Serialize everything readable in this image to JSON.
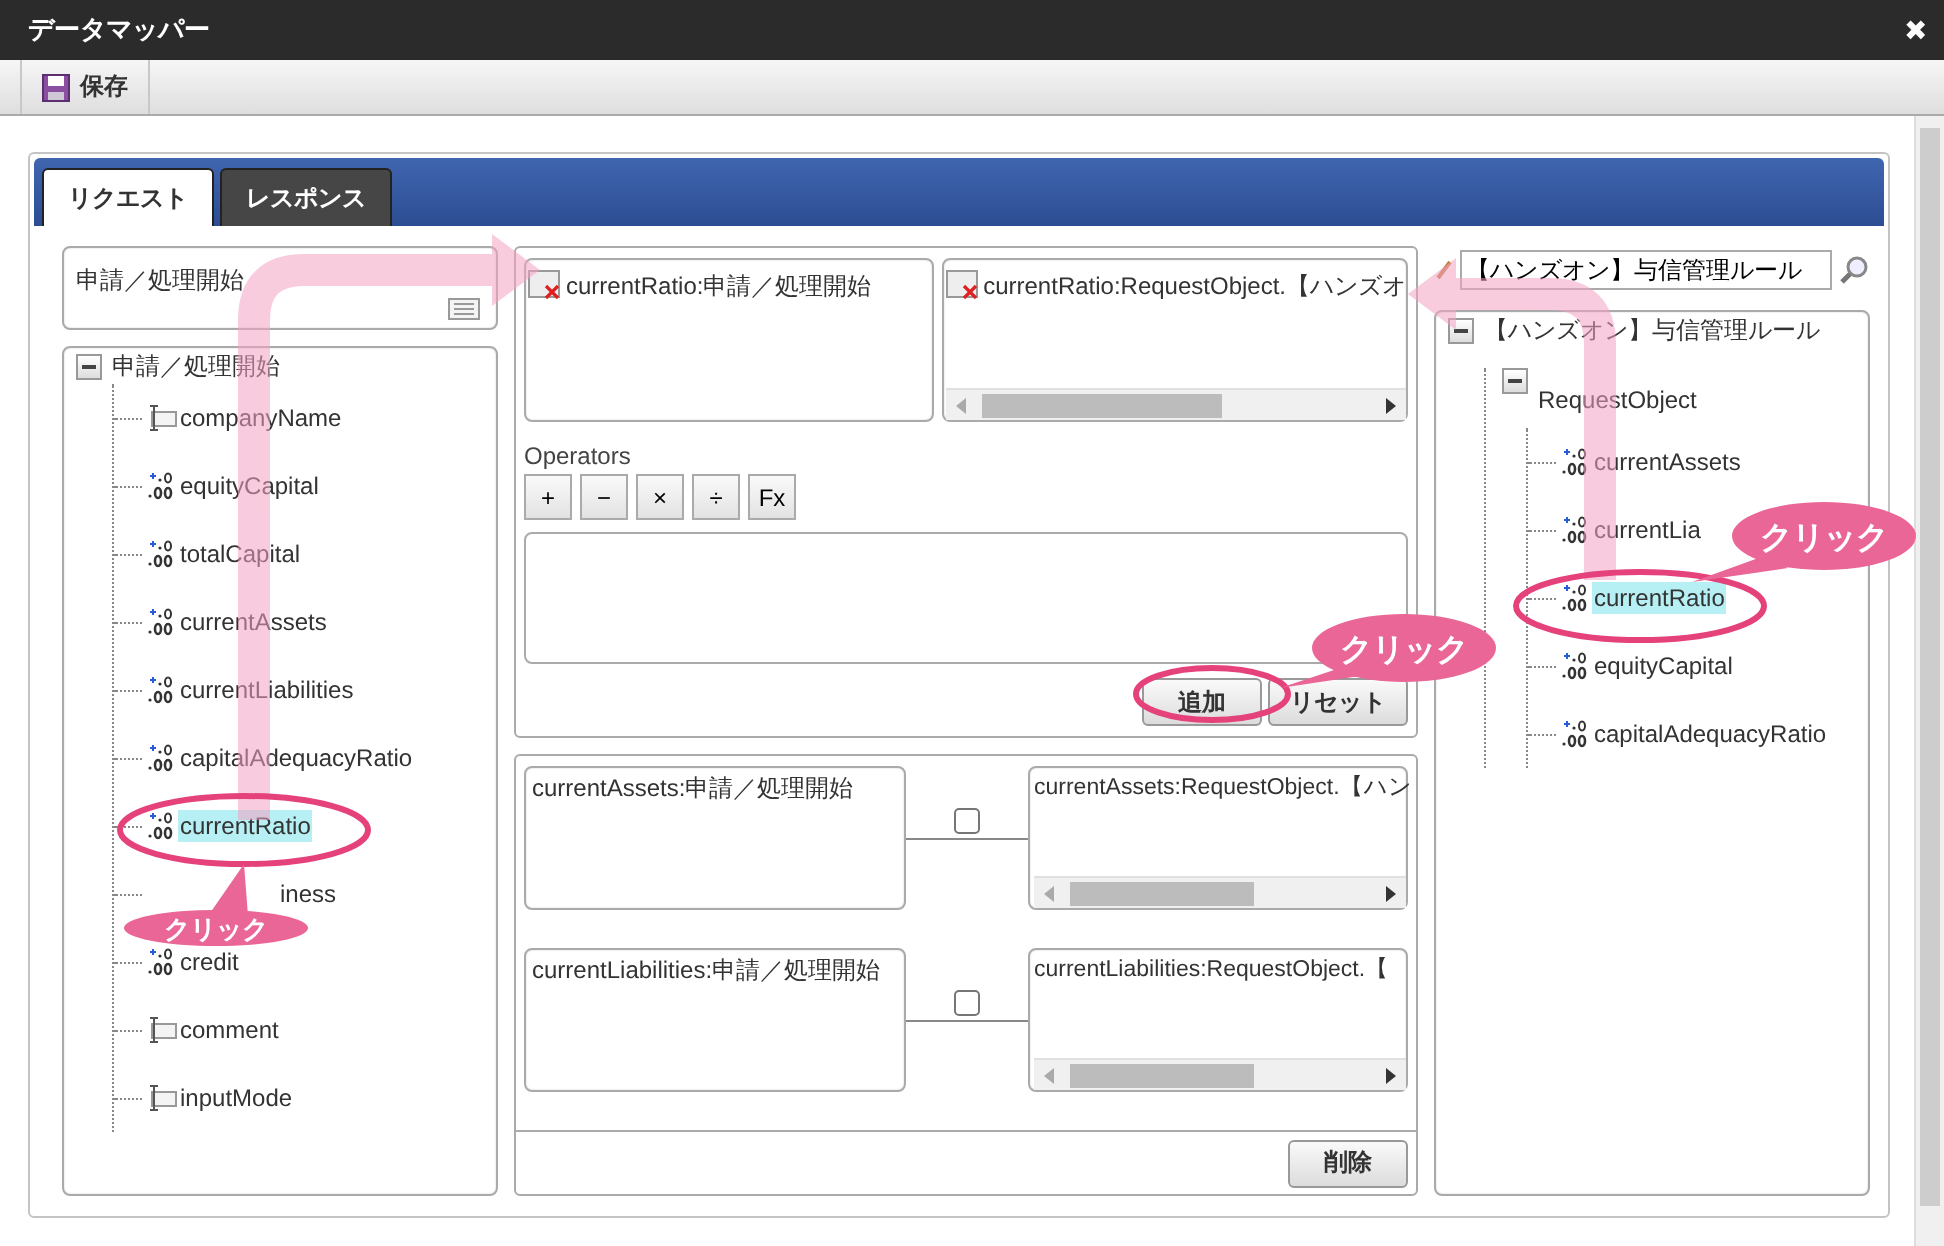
{
  "window": {
    "title": "データマッパー",
    "close": "✖"
  },
  "toolbar": {
    "save": "保存"
  },
  "tabs": [
    {
      "label": "リクエスト",
      "selected": true
    },
    {
      "label": "レスポンス",
      "selected": false
    }
  ],
  "source": {
    "header": "申請／処理開始",
    "tree": {
      "label": "申請／処理開始",
      "expanded": true,
      "children": [
        {
          "label": "companyName",
          "kind": "text",
          "selected": false
        },
        {
          "label": "equityCapital",
          "kind": "number",
          "selected": false
        },
        {
          "label": "totalCapital",
          "kind": "number",
          "selected": false
        },
        {
          "label": "currentAssets",
          "kind": "number",
          "selected": false
        },
        {
          "label": "currentLiabilities",
          "kind": "number",
          "selected": false
        },
        {
          "label": "capitalAdequacyRatio",
          "kind": "number",
          "selected": false
        },
        {
          "label": "currentRatio",
          "kind": "number",
          "selected": true
        },
        {
          "label": "iness",
          "kind": "hidden",
          "selected": false
        },
        {
          "label": "credit",
          "kind": "number",
          "selected": false
        },
        {
          "label": "comment",
          "kind": "text",
          "selected": false
        },
        {
          "label": "inputMode",
          "kind": "text",
          "selected": false
        }
      ]
    }
  },
  "selection": {
    "source": "currentRatio:申請／処理開始",
    "target": "currentRatio:RequestObject.【ハンズオ"
  },
  "operators": {
    "label": "Operators",
    "buttons": [
      "+",
      "−",
      "×",
      "÷",
      "Fx"
    ]
  },
  "actions": [
    "追加",
    "リセット"
  ],
  "mappings": [
    {
      "source": "currentAssets:申請／処理開始",
      "target": "currentAssets:RequestObject.【ハン",
      "checked": false
    },
    {
      "source": "currentLiabilities:申請／処理開始",
      "target": "currentLiabilities:RequestObject.【",
      "checked": false
    }
  ],
  "delete": "削除",
  "target": {
    "search": "【ハンズオン】与信管理ルール",
    "tree": {
      "label": "【ハンズオン】与信管理ルール",
      "expanded": true,
      "children": [
        {
          "label": "RequestObject",
          "expanded": true,
          "children": [
            {
              "label": "currentAssets",
              "kind": "number",
              "selected": false
            },
            {
              "label": "currentLia",
              "kind": "number",
              "selected": false
            },
            {
              "label": "currentRatio",
              "kind": "number",
              "selected": true
            },
            {
              "label": "equityCapital",
              "kind": "number",
              "selected": false
            },
            {
              "label": "capitalAdequacyRatio",
              "kind": "number",
              "selected": false
            }
          ]
        }
      ]
    }
  },
  "callouts": [
    "クリック",
    "クリック",
    "クリック"
  ]
}
